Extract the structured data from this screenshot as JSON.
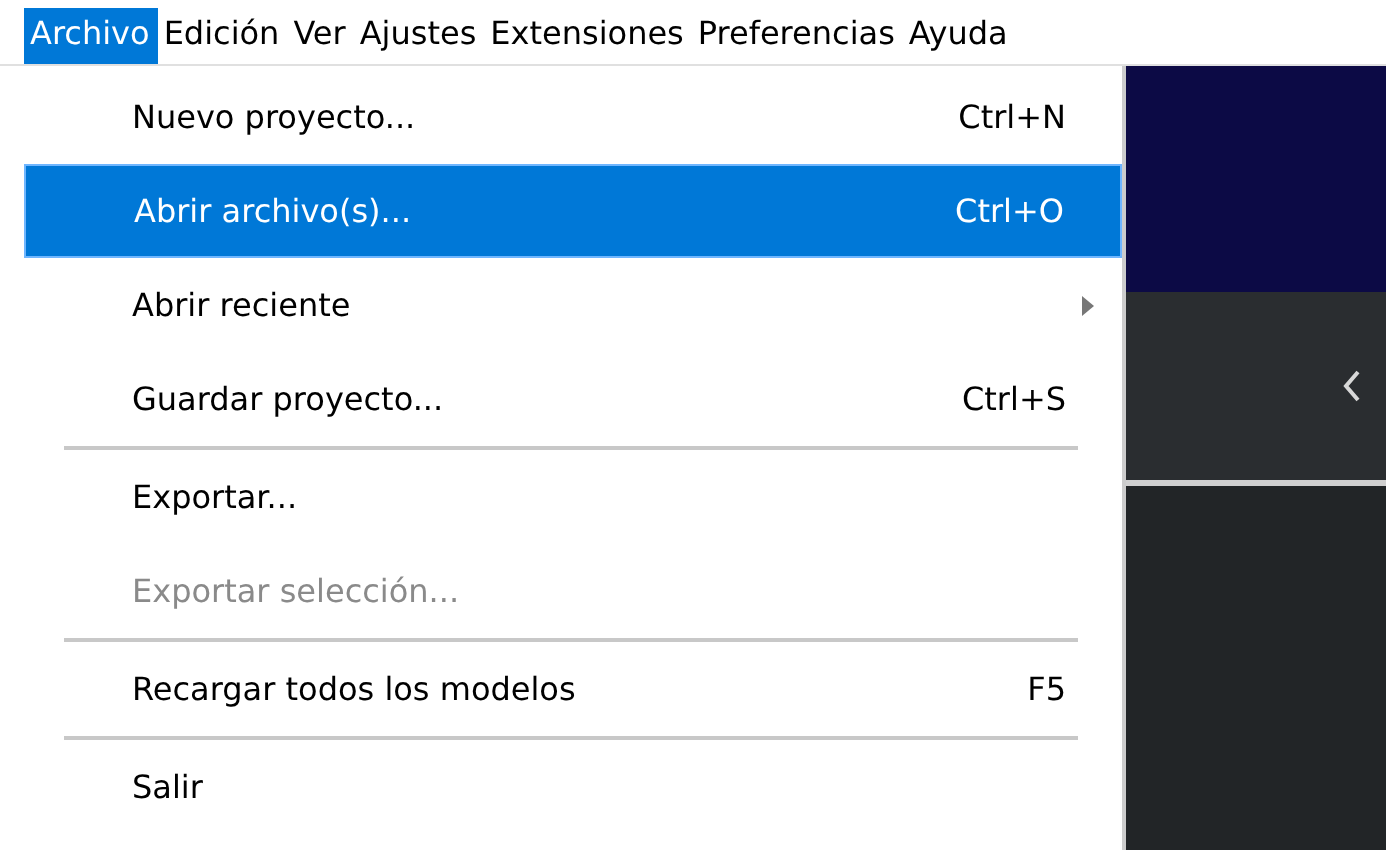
{
  "menu_bar": [
    {
      "label": "Archivo",
      "selected": true
    },
    {
      "label": "Edición",
      "selected": false
    },
    {
      "label": "Ver",
      "selected": false
    },
    {
      "label": "Ajustes",
      "selected": false
    },
    {
      "label": "Extensiones",
      "selected": false
    },
    {
      "label": "Preferencias",
      "selected": false
    },
    {
      "label": "Ayuda",
      "selected": false
    }
  ],
  "menu": [
    {
      "kind": "item",
      "label": "Nuevo proyecto...",
      "shortcut": "Ctrl+N",
      "selected": false,
      "disabled": false,
      "submenu": false
    },
    {
      "kind": "item",
      "label": "Abrir archivo(s)...",
      "shortcut": "Ctrl+O",
      "selected": true,
      "disabled": false,
      "submenu": false
    },
    {
      "kind": "item",
      "label": "Abrir reciente",
      "selected": false,
      "disabled": false,
      "submenu": true
    },
    {
      "kind": "item",
      "label": "Guardar proyecto...",
      "shortcut": "Ctrl+S",
      "selected": false,
      "disabled": false,
      "submenu": false
    },
    {
      "kind": "separator"
    },
    {
      "kind": "item",
      "label": "Exportar...",
      "selected": false,
      "disabled": false,
      "submenu": false
    },
    {
      "kind": "item",
      "label": "Exportar selección...",
      "selected": false,
      "disabled": true,
      "submenu": false
    },
    {
      "kind": "separator"
    },
    {
      "kind": "item",
      "label": "Recargar todos los modelos",
      "shortcut": "F5",
      "selected": false,
      "disabled": false,
      "submenu": false
    },
    {
      "kind": "separator"
    },
    {
      "kind": "item",
      "label": "Salir",
      "selected": false,
      "disabled": false,
      "submenu": false
    }
  ]
}
